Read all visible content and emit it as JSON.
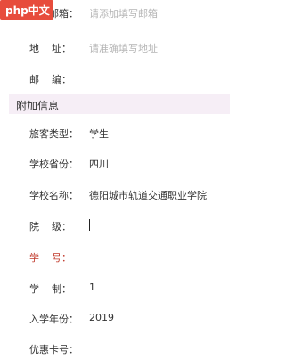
{
  "watermark": {
    "text": "php中文网"
  },
  "contact": {
    "email": {
      "label": "电子邮箱：",
      "placeholder": "请添加填写邮箱"
    },
    "address": {
      "label": "地    址：",
      "placeholder": "请准确填写地址"
    },
    "postcode": {
      "label": "邮    编：",
      "value": ""
    }
  },
  "section": {
    "title": "附加信息"
  },
  "extra": {
    "traveler_type": {
      "label": "旅客类型：",
      "value": "学生"
    },
    "school_province": {
      "label": "学校省份：",
      "value": "四川"
    },
    "school_name": {
      "label": "学校名称：",
      "value": "德阳城市轨道交通职业学院"
    },
    "department": {
      "label": "院    级：",
      "value": ""
    },
    "student_no": {
      "label": "学    号：",
      "value": ""
    },
    "schooling_years": {
      "label": "学    制：",
      "value": "1"
    },
    "enrollment_year": {
      "label": "入学年份：",
      "value": "2019"
    },
    "discount_card": {
      "label": "优惠卡号：",
      "value": ""
    }
  }
}
